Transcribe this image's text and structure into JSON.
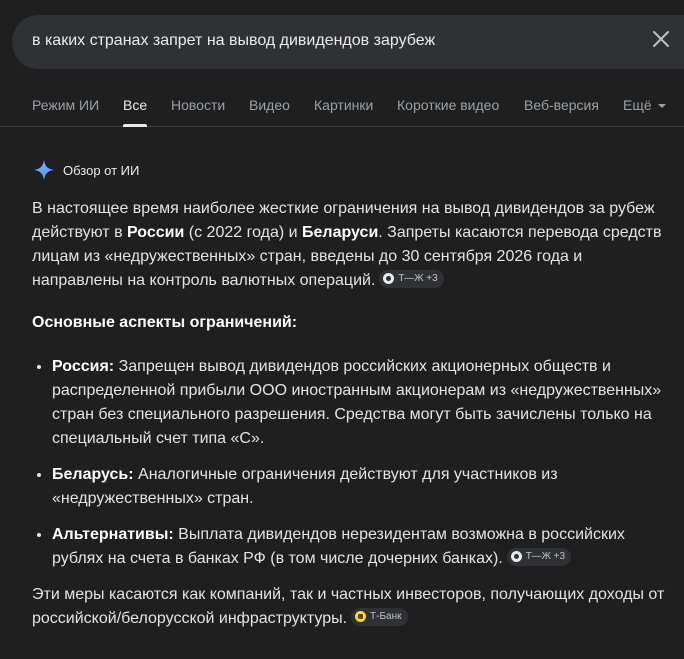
{
  "search": {
    "query": "в каких странах запрет на вывод дивидендов зарубеж"
  },
  "tabs": [
    {
      "label": "Режим ИИ"
    },
    {
      "label": "Все"
    },
    {
      "label": "Новости"
    },
    {
      "label": "Видео"
    },
    {
      "label": "Картинки"
    },
    {
      "label": "Короткие видео"
    },
    {
      "label": "Веб-версия"
    },
    {
      "label": "Ещё"
    }
  ],
  "ai_overview": {
    "title": "Обзор от ИИ",
    "para1": {
      "t1": "В настоящее время наиболее жесткие ограничения на вывод дивидендов за рубеж действуют в ",
      "b1": "России",
      "t2": " (с 2022 года) и ",
      "b2": "Беларуси",
      "t3": ". Запреты касаются перевода средств лицам из «недружественных» стран, введены до 30 сентября 2026 года и направлены на контроль валютных операций.",
      "chip": "Т—Ж +3"
    },
    "heading": "Основные аспекты ограничений:",
    "items": [
      {
        "label": "Россия:",
        "text": " Запрещен вывод дивидендов российских акционерных обществ и распределенной прибыли ООО иностранным акционерам из «недружественных» стран без специального разрешения. Средства могут быть зачислены только на специальный счет типа «С»."
      },
      {
        "label": "Беларусь:",
        "text": " Аналогичные ограничения действуют для участников из «недружественных» стран."
      },
      {
        "label": "Альтернативы:",
        "text": " Выплата дивидендов нерезидентам возможна в российских рублях на счета в банках РФ (в том числе дочерних банках).",
        "chip": "Т—Ж +3"
      }
    ],
    "para_last": {
      "text": "Эти меры касаются как компаний, так и частных инвесторов, получающих доходы от российской/белорусской инфраструктуры.",
      "chip": "Т-Банк"
    }
  },
  "colors": {
    "background": "#1f1f1f",
    "search_bg": "#303134",
    "accent_sparkle": "#4f8bf0",
    "tbank_yellow": "#fdd835"
  }
}
